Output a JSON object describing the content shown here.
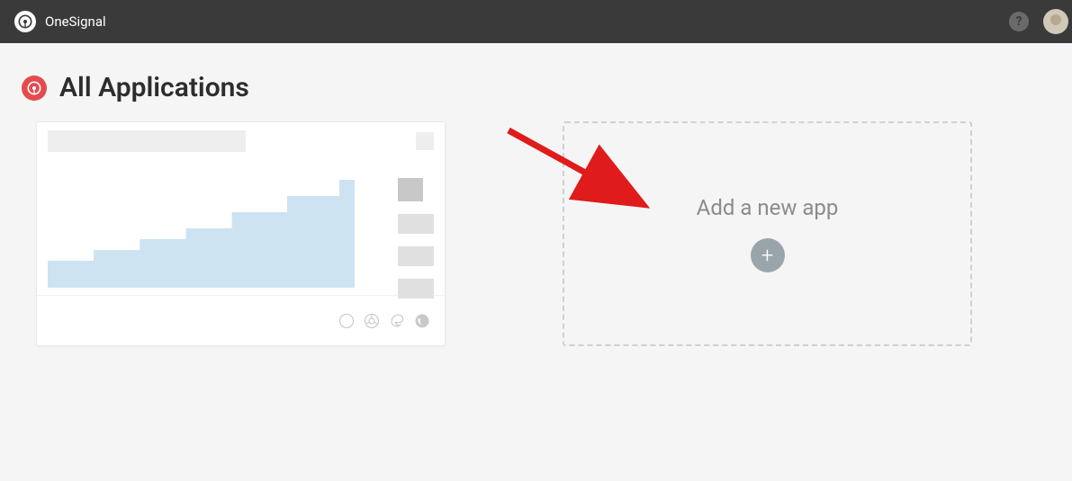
{
  "brand": "OneSignal",
  "header": {
    "title": "All Applications"
  },
  "add_card": {
    "title": "Add a new app"
  },
  "icons": {
    "help": "?",
    "plus": "+"
  }
}
